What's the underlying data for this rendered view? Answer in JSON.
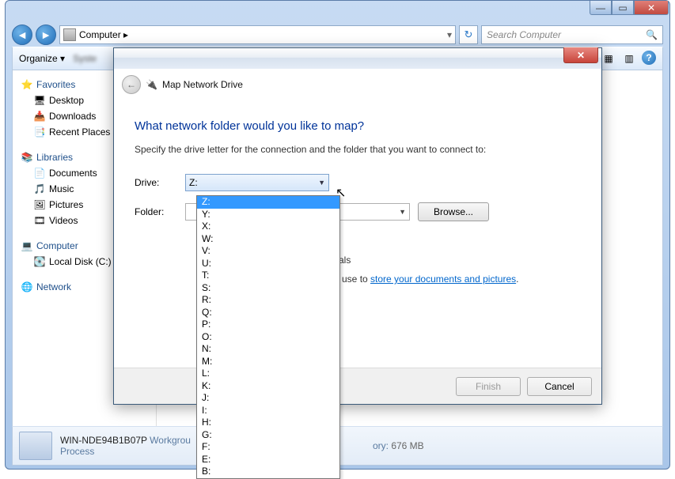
{
  "address_bar": {
    "location": "Computer",
    "arrow": "▸"
  },
  "search": {
    "placeholder": "Search Computer"
  },
  "toolbar": {
    "organize": "Organize ▾",
    "sys_blur": "Syste"
  },
  "sidebar": {
    "favorites": "Favorites",
    "desktop": "Desktop",
    "downloads": "Downloads",
    "recent": "Recent Places",
    "libraries": "Libraries",
    "documents": "Documents",
    "music": "Music",
    "pictures": "Pictures",
    "videos": "Videos",
    "computer": "Computer",
    "local_disk": "Local Disk (C:)",
    "network": "Network"
  },
  "status": {
    "pc_name": "WIN-NDE94B1B07P",
    "workgroup_lbl": "Workgrou",
    "processor_lbl": "Process",
    "memory_lbl": "ory:",
    "memory_val": "676 MB"
  },
  "dialog": {
    "title": "Map Network Drive",
    "heading": "What network folder would you like to map?",
    "subtitle": "Specify the drive letter for the connection and the folder that you want to connect to:",
    "drive_label": "Drive:",
    "folder_label": "Folder:",
    "drive_value": "Z:",
    "browse": "Browse...",
    "cred_text": "tials",
    "link_prefix": "n use to ",
    "link_text": "store your documents and pictures",
    "finish": "Finish",
    "cancel": "Cancel"
  },
  "drive_options": [
    "Z:",
    "Y:",
    "X:",
    "W:",
    "V:",
    "U:",
    "T:",
    "S:",
    "R:",
    "Q:",
    "P:",
    "O:",
    "N:",
    "M:",
    "L:",
    "K:",
    "J:",
    "I:",
    "H:",
    "G:",
    "F:",
    "E:",
    "B:"
  ]
}
